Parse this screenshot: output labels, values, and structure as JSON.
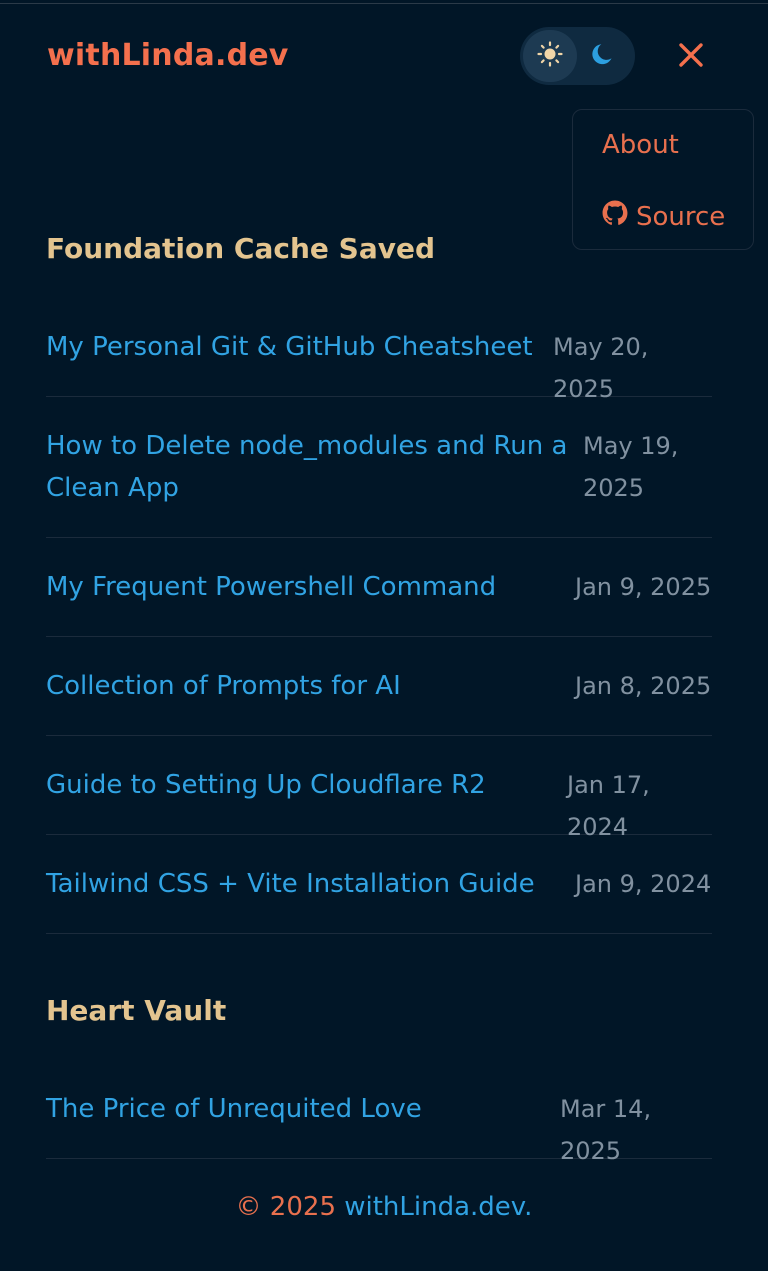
{
  "header": {
    "brand": "withLinda.dev",
    "theme_toggle": {
      "light_icon": "sun-icon",
      "dark_icon": "moon-icon",
      "active": "light"
    },
    "close_icon": "close-icon"
  },
  "menu": {
    "about_label": "About",
    "source_label": "Source",
    "source_icon": "github-icon"
  },
  "sections": [
    {
      "title": "Foundation Cache Saved",
      "posts": [
        {
          "title": "My Personal Git & GitHub Cheatsheet",
          "date": "May 20, 2025"
        },
        {
          "title_line1": "How to Delete node_modules and Run a",
          "title_line2": "Clean App",
          "date_line1": "May 19,",
          "date_line2": "2025"
        },
        {
          "title": "My Frequent Powershell Command",
          "date": "Jan 9, 2025"
        },
        {
          "title": "Collection of Prompts for AI",
          "date": "Jan 8, 2025"
        },
        {
          "title": "Guide to Setting Up Cloudflare R2",
          "date": "Jan 17, 2024"
        },
        {
          "title": "Tailwind CSS + Vite Installation Guide",
          "date": "Jan 9, 2024"
        }
      ]
    },
    {
      "title": "Heart Vault",
      "posts": [
        {
          "title": "The Price of Unrequited Love",
          "date": "Mar 14, 2025"
        }
      ]
    }
  ],
  "footer": {
    "copyright": "© 2025",
    "site": "withLinda.dev",
    "period": "."
  },
  "colors": {
    "background": "#011627",
    "accent": "#f4704d",
    "link": "#31a3e3",
    "section_heading": "#e3c48f",
    "date": "#8191a0"
  }
}
